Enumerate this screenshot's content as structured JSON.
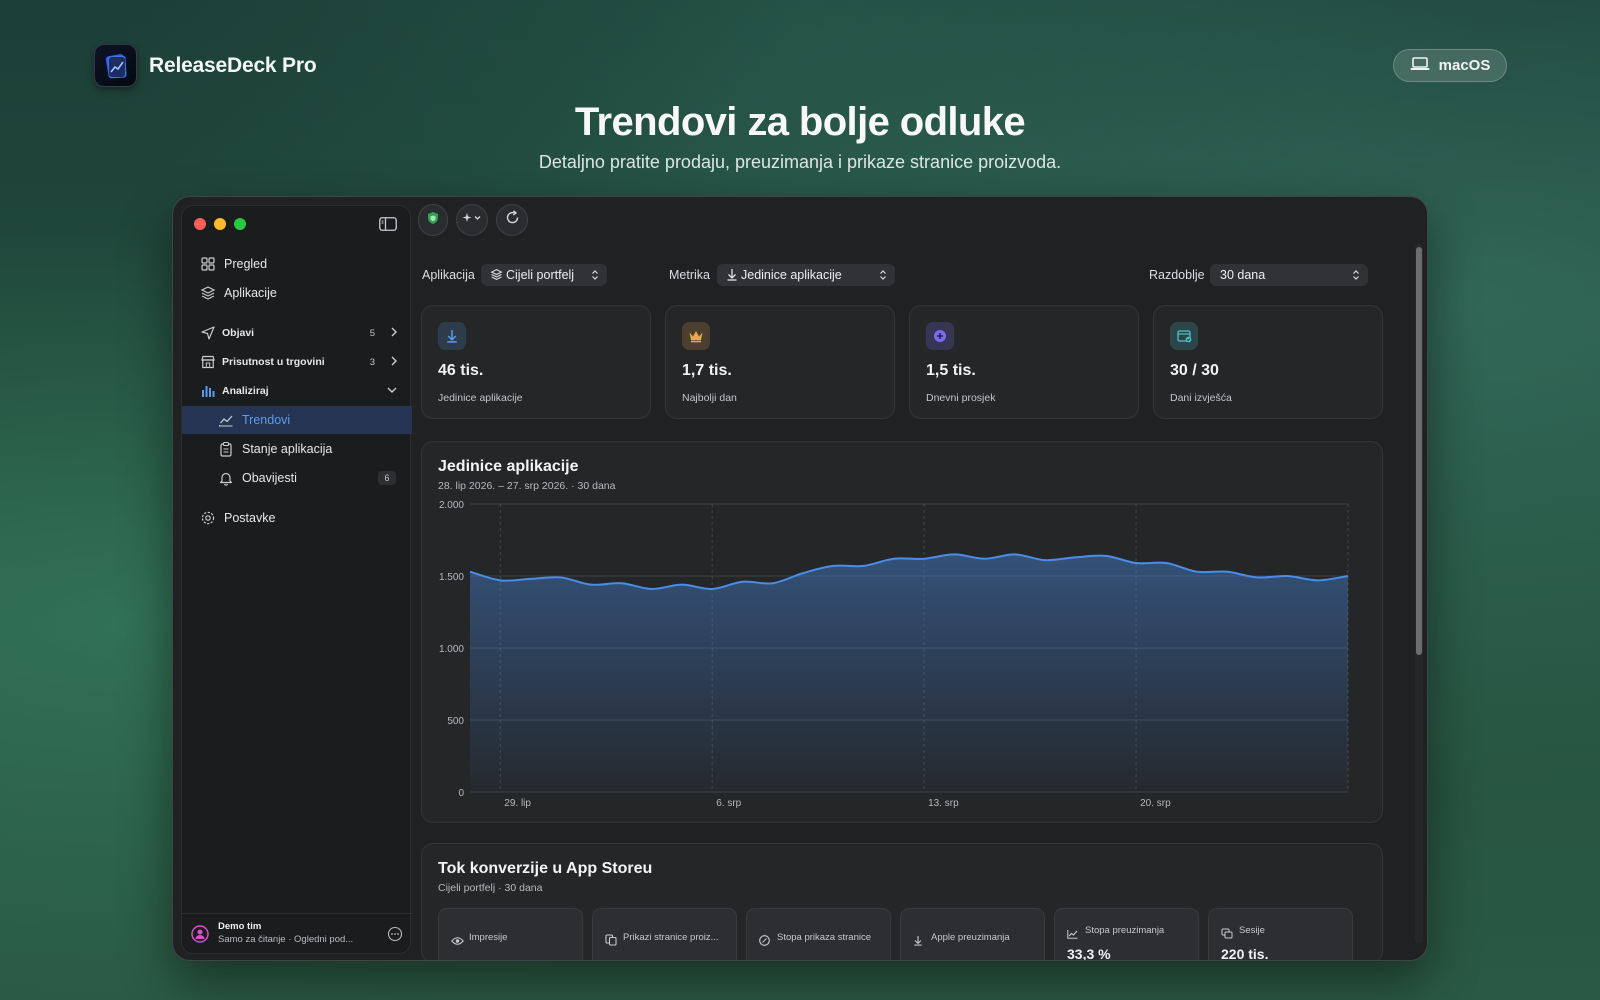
{
  "brand": {
    "name": "ReleaseDeck Pro"
  },
  "platform": {
    "label": "macOS"
  },
  "hero": {
    "title": "Trendovi za bolje odluke",
    "subtitle": "Detaljno pratite prodaju, preuzimanja i prikaze stranice proizvoda."
  },
  "sidebar": {
    "items": [
      {
        "label": "Pregled",
        "icon": "grid-icon"
      },
      {
        "label": "Aplikacije",
        "icon": "layers-icon"
      },
      {
        "label": "Objavi",
        "icon": "send-icon",
        "count": "5"
      },
      {
        "label": "Prisutnost u trgovini",
        "icon": "store-icon",
        "count": "3"
      },
      {
        "label": "Analiziraj",
        "icon": "bar-chart-icon"
      },
      {
        "label": "Trendovi",
        "icon": "line-chart-icon",
        "active": true
      },
      {
        "label": "Stanje aplikacija",
        "icon": "clipboard-icon"
      },
      {
        "label": "Obavijesti",
        "icon": "bell-icon",
        "count": "6"
      },
      {
        "label": "Postavke",
        "icon": "gear-icon"
      }
    ],
    "footer": {
      "team": "Demo tim",
      "subtitle": "Samo za čitanje · Ogledni pod..."
    }
  },
  "filters": {
    "app_label": "Aplikacija",
    "app_value": "Cijeli portfelj",
    "metric_label": "Metrika",
    "metric_value": "Jedinice aplikacije",
    "period_label": "Razdoblje",
    "period_value": "30 dana"
  },
  "stats": [
    {
      "value": "46 tis.",
      "label": "Jedinice aplikacije",
      "icon": "download-icon",
      "color": "#5b9bf0"
    },
    {
      "value": "1,7 tis.",
      "label": "Najbolji dan",
      "icon": "crown-icon",
      "color": "#f0a64a"
    },
    {
      "value": "1,5 tis.",
      "label": "Dnevni prosjek",
      "icon": "plus-circle-icon",
      "color": "#7a6cf0"
    },
    {
      "value": "30 / 30",
      "label": "Dani izvješća",
      "icon": "calendar-check-icon",
      "color": "#4fc3c8"
    }
  ],
  "chart_panel": {
    "title": "Jedinice aplikacije",
    "subtitle": "28. lip 2026. – 27. srp 2026. · 30 dana"
  },
  "chart_data": {
    "type": "area",
    "title": "Jedinice aplikacije",
    "ylim": [
      0,
      2000
    ],
    "yticks": [
      "0",
      "500",
      "1.000",
      "1.500",
      "2.000"
    ],
    "xticks": [
      "29. lip",
      "6. srp",
      "13. srp",
      "20. srp"
    ],
    "grid": true,
    "color": "#4a8de8",
    "series": [
      {
        "values": [
          1530,
          1470,
          1480,
          1490,
          1440,
          1450,
          1410,
          1440,
          1410,
          1460,
          1450,
          1520,
          1570,
          1570,
          1620,
          1620,
          1650,
          1620,
          1650,
          1610,
          1630,
          1640,
          1590,
          1590,
          1530,
          1530,
          1490,
          1500,
          1470,
          1500
        ]
      }
    ]
  },
  "conversion": {
    "title": "Tok konverzije u App Storeu",
    "subtitle": "Cijeli portfelj · 30 dana",
    "cards": [
      {
        "label": "Impresije",
        "icon": "eye-icon",
        "value": ""
      },
      {
        "label": "Prikazi stranice proiz...",
        "icon": "pages-icon",
        "value": ""
      },
      {
        "label": "Stopa prikaza stranice",
        "icon": "percent-icon",
        "value": ""
      },
      {
        "label": "Apple preuzimanja",
        "icon": "download-icon",
        "value": ""
      },
      {
        "label": "Stopa preuzimanja",
        "icon": "trend-icon",
        "value": "33,3 %"
      },
      {
        "label": "Sesije",
        "icon": "sessions-icon",
        "value": "220 tis."
      }
    ]
  }
}
